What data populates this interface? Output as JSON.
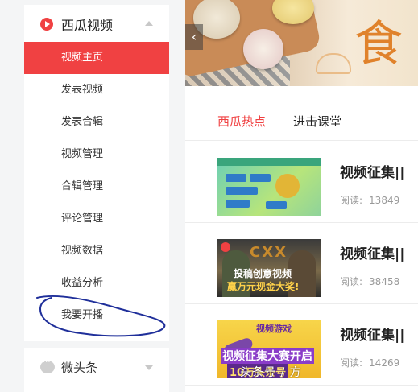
{
  "sidebar": {
    "section_title": "西瓜视频",
    "items": [
      {
        "label": "视频主页",
        "active": true
      },
      {
        "label": "发表视频",
        "active": false
      },
      {
        "label": "发表合辑",
        "active": false
      },
      {
        "label": "视频管理",
        "active": false
      },
      {
        "label": "合辑管理",
        "active": false
      },
      {
        "label": "评论管理",
        "active": false
      },
      {
        "label": "视频数据",
        "active": false
      },
      {
        "label": "收益分析",
        "active": false
      },
      {
        "label": "我要开播",
        "active": false
      }
    ],
    "section2_title": "微头条"
  },
  "banner": {
    "glyph": "食",
    "prev_icon": "chevron-left-icon"
  },
  "tabs": [
    {
      "label": "西瓜热点",
      "active": true
    },
    {
      "label": "进击课堂",
      "active": false
    }
  ],
  "articles": [
    {
      "title": "视频征集||",
      "read_label": "阅读:",
      "reads": "13849"
    },
    {
      "title": "视频征集||",
      "read_label": "阅读:",
      "reads": "38458"
    },
    {
      "title": "视频征集||",
      "read_label": "阅读:",
      "reads": "14269"
    }
  ],
  "thumbnails": {
    "thumb2_logo": "CXX",
    "thumb2_line1": "投稿创意视频",
    "thumb2_line2": "赢万元现金大奖!",
    "thumb3_top": "视频游戏",
    "thumb3_mid": "视频征集大赛开启",
    "thumb3_bottom": "10万头条号"
  },
  "watermark": "头条号 / 方",
  "colors": {
    "accent": "#f04142",
    "annotation_circle": "#1f2f9a"
  }
}
